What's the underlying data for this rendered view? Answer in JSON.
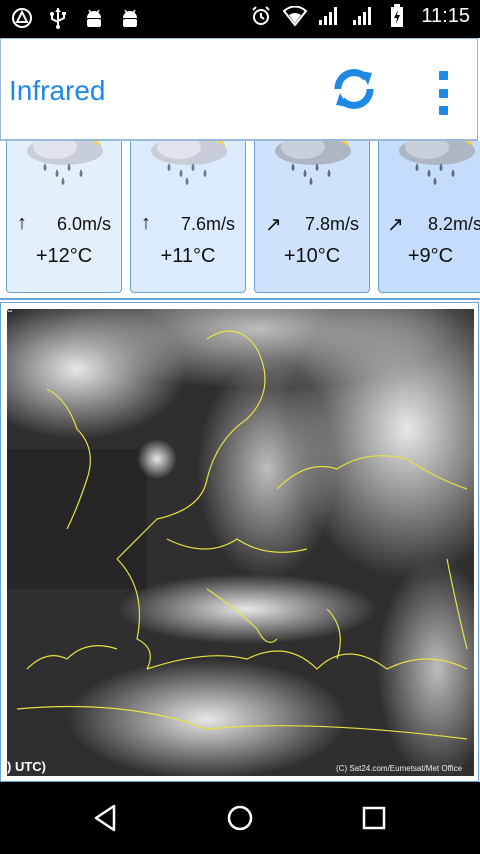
{
  "status_bar": {
    "time": "11:15",
    "left_icons": [
      "assistant-icon",
      "usb-icon",
      "android-icon",
      "android-icon"
    ],
    "right_icons": [
      "alarm-icon",
      "wifi-icon",
      "signal-icon",
      "signal-icon",
      "battery-charging-icon"
    ]
  },
  "app_bar": {
    "title": "Infrared",
    "actions": [
      "refresh-icon",
      "overflow-menu-icon"
    ],
    "accent_color": "#1e88e5"
  },
  "forecast": [
    {
      "icon": "rain-snow-icon",
      "wind_direction": "↑",
      "wind": "6.0m/s",
      "temp": "+12°C",
      "bg": "#e3f0fc"
    },
    {
      "icon": "rain-snow-icon",
      "wind_direction": "↑",
      "wind": "7.6m/s",
      "temp": "+11°C",
      "bg": "#dbeafc"
    },
    {
      "icon": "rain-snow-icon",
      "wind_direction": "↗",
      "wind": "7.8m/s",
      "temp": "+10°C",
      "bg": "#cfe2fb"
    },
    {
      "icon": "rain-snow-icon",
      "wind_direction": "↗",
      "wind": "8.2m/s",
      "temp": "+9°C",
      "bg": "#c6dcfb"
    }
  ],
  "map": {
    "caption_left": ") UTC)",
    "caption_right": "(C) Sat24.com/Eumetsat/Met Office",
    "corner_label": "TC"
  },
  "nav_bar": {
    "buttons": [
      "back-icon",
      "home-icon",
      "recents-icon"
    ]
  }
}
